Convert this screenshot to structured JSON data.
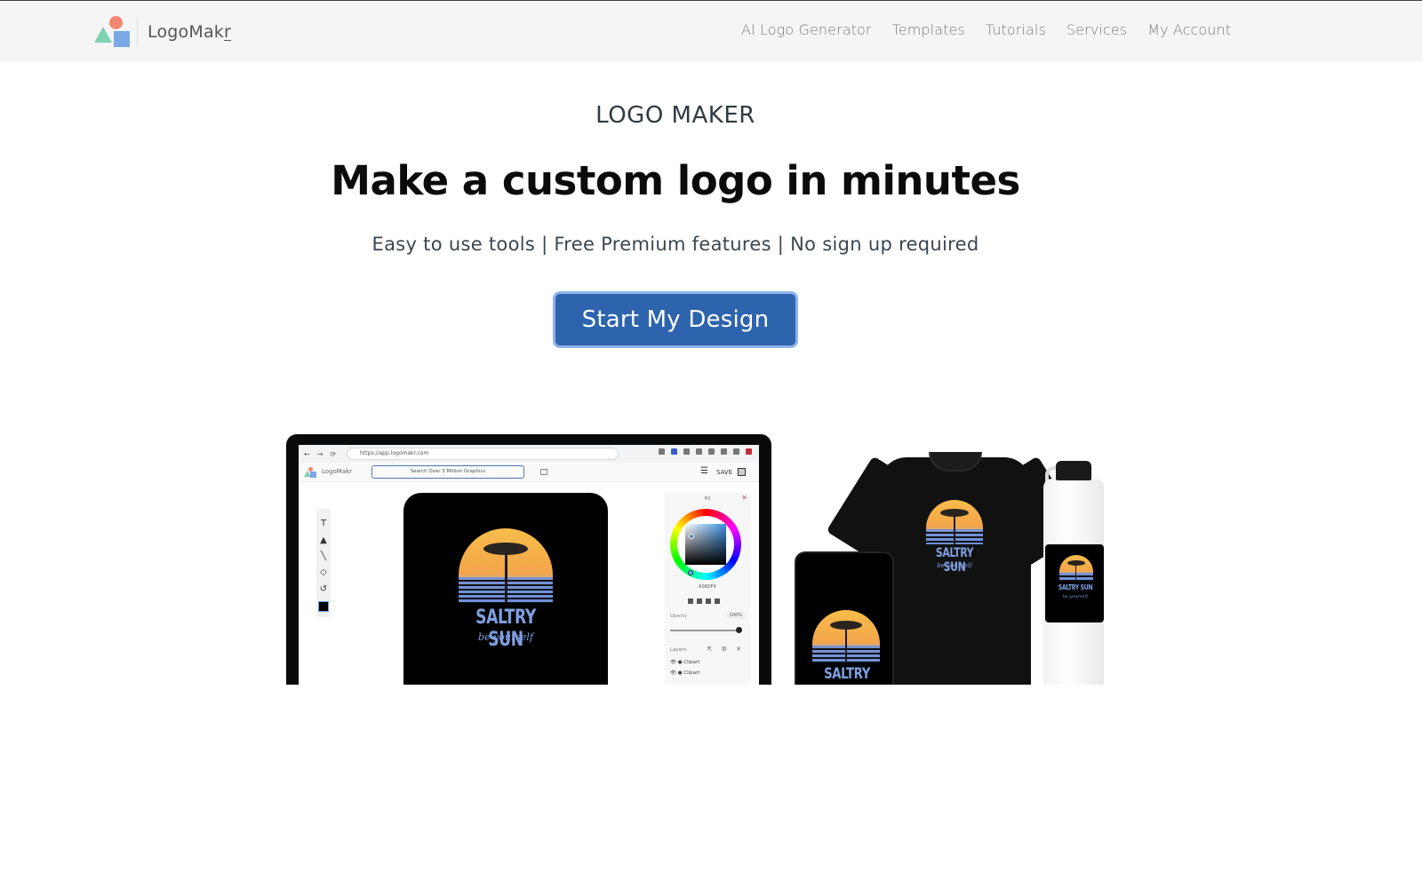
{
  "header": {
    "brand": {
      "name_main": "LogoMak",
      "name_underlined": "r",
      "icon": "logomakr-shapes-logo"
    },
    "nav": [
      {
        "label": "AI Logo Generator"
      },
      {
        "label": "Templates"
      },
      {
        "label": "Tutorials"
      },
      {
        "label": "Services"
      },
      {
        "label": "My Account"
      }
    ]
  },
  "hero": {
    "eyebrow": "LOGO MAKER",
    "headline": "Make a custom logo in minutes",
    "subhead": "Easy to use tools | Free Premium features | No sign up required",
    "cta_label": "Start My Design",
    "colors": {
      "cta_bg": "#2d64ad",
      "cta_border": "#8fb4ea"
    }
  },
  "mockup": {
    "browser": {
      "url": "https://app.logomakr.com",
      "nav_buttons": [
        "←",
        "→",
        "⟳"
      ]
    },
    "editor": {
      "app_name": "LogoMakr",
      "search_placeholder": "Search Over 3 Million Graphics",
      "save_label": "SAVE",
      "menu_icon": "☰",
      "tools": [
        "T",
        "▲",
        "╲",
        "◇",
        "↺"
      ],
      "fill_panel": {
        "title": "Fill",
        "close": "✕",
        "hex_value": "606DF4",
        "opacity_label": "Opacity",
        "opacity_value": "100%",
        "opacity": 1.0,
        "layers_label": "Layers",
        "layers_icons": "⇱ ⚙ ✕",
        "layers": [
          {
            "label": "Clipart"
          },
          {
            "label": "Clipart"
          }
        ]
      }
    },
    "logo": {
      "title": "SALTRY SUN",
      "tagline": "be yourself"
    },
    "products": [
      "laptop",
      "phone",
      "t-shirt",
      "water-bottle"
    ]
  }
}
